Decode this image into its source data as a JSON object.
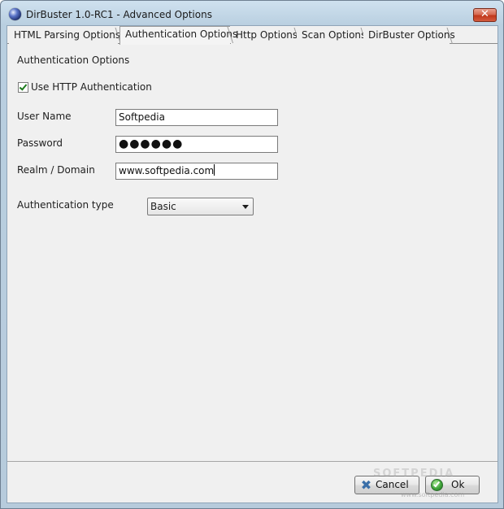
{
  "window": {
    "title": "DirBuster 1.0-RC1 - Advanced Options",
    "close_glyph": "✕"
  },
  "tabs": [
    {
      "label": "HTML Parsing Options",
      "active": false
    },
    {
      "label": "Authentication Options",
      "active": true
    },
    {
      "label": "Http Options",
      "active": false
    },
    {
      "label": "Scan Options",
      "active": false
    },
    {
      "label": "DirBuster Options",
      "active": false
    }
  ],
  "auth": {
    "section_title": "Authentication Options",
    "use_http_auth_label": "Use HTTP Authentication",
    "use_http_auth_checked": true,
    "username_label": "User Name",
    "username_value": "Softpedia",
    "password_label": "Password",
    "password_value": "●●●●●●",
    "realm_label": "Realm / Domain",
    "realm_value": "www.softpedia.com",
    "auth_type_label": "Authentication type",
    "auth_type_value": "Basic"
  },
  "buttons": {
    "cancel_label": "Cancel",
    "ok_label": "Ok"
  },
  "watermark": {
    "text": "SOFTPEDIA",
    "url": "www.softpedia.com"
  },
  "icons": {
    "app": "dirbuster-globe-icon",
    "close": "close-icon",
    "check": "checkmark-icon",
    "dropdown": "chevron-down-icon",
    "cancel": "cancel-x-icon",
    "ok": "ok-check-icon"
  }
}
